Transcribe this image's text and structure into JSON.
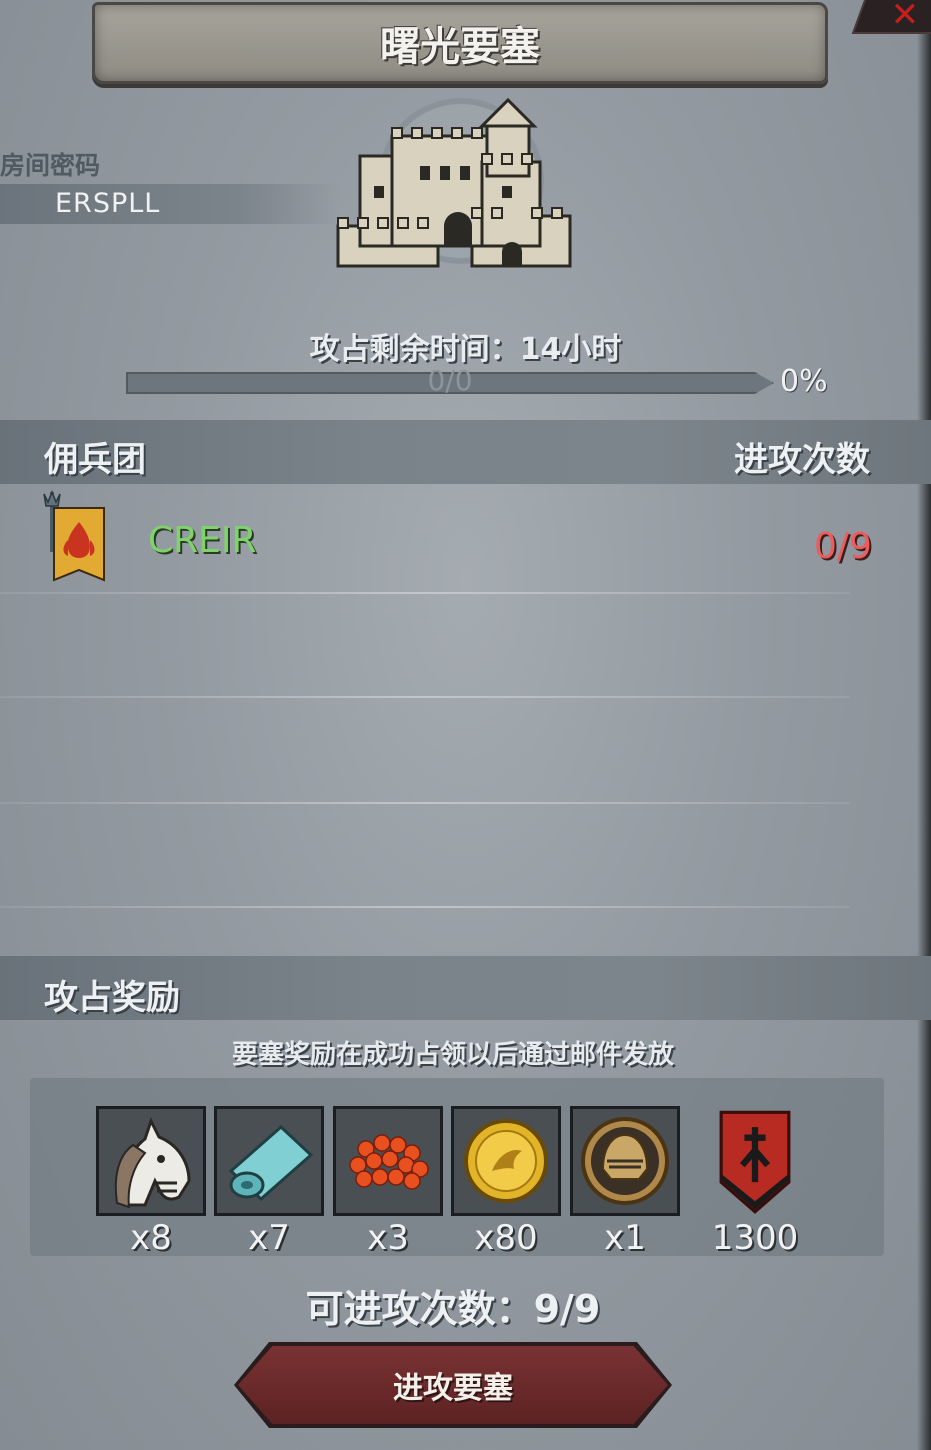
{
  "header": {
    "title": "曙光要塞",
    "close_icon": "close-x-icon"
  },
  "room": {
    "label": "房间密码",
    "code": "ERSPLL"
  },
  "timer": {
    "text": "攻占剩余时间：14小时"
  },
  "progress": {
    "text": "0/0",
    "percent_text": "0%",
    "fill": 0
  },
  "mercenary": {
    "section_title": "佣兵团",
    "attacks_header": "进攻次数",
    "entries": [
      {
        "name": "CREIR",
        "count": "0/9",
        "icon": "flame-banner-icon"
      }
    ]
  },
  "rewards": {
    "section_title": "攻占奖励",
    "note": "要塞奖励在成功占领以后通过邮件发放",
    "items": [
      {
        "icon": "horse-icon",
        "qty": "x8"
      },
      {
        "icon": "cloth-roll-icon",
        "qty": "x7"
      },
      {
        "icon": "red-beads-icon",
        "qty": "x3"
      },
      {
        "icon": "gold-coin-icon",
        "qty": "x80"
      },
      {
        "icon": "helmet-medal-icon",
        "qty": "x1"
      },
      {
        "icon": "red-shield-icon",
        "qty": "1300"
      }
    ]
  },
  "attack": {
    "remaining_text": "可进攻次数：9/9",
    "button_label": "进攻要塞"
  },
  "colors": {
    "green_name": "#7fd36b",
    "red_count": "#ef5b5b",
    "button": "#6b2a2b"
  }
}
